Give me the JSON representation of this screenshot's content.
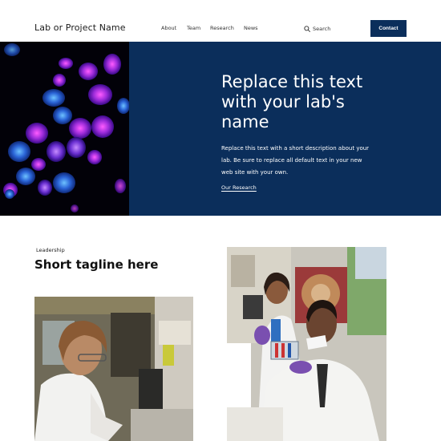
{
  "header": {
    "logo": "Lab or Project Name",
    "nav": [
      {
        "label": "About"
      },
      {
        "label": "Team"
      },
      {
        "label": "Research"
      },
      {
        "label": "News"
      }
    ],
    "search_label": "Search",
    "contact_label": "Contact"
  },
  "hero": {
    "title": "Replace this text with your lab's name",
    "description": "Replace this text with a short description about your lab. Be sure to replace all default text in your new web site with your own.",
    "link_label": "Our Research"
  },
  "section": {
    "eyebrow": "Leadership",
    "tagline": "Short tagline here"
  },
  "colors": {
    "brand_navy": "#0b2e5b",
    "background": "#ffffff"
  }
}
